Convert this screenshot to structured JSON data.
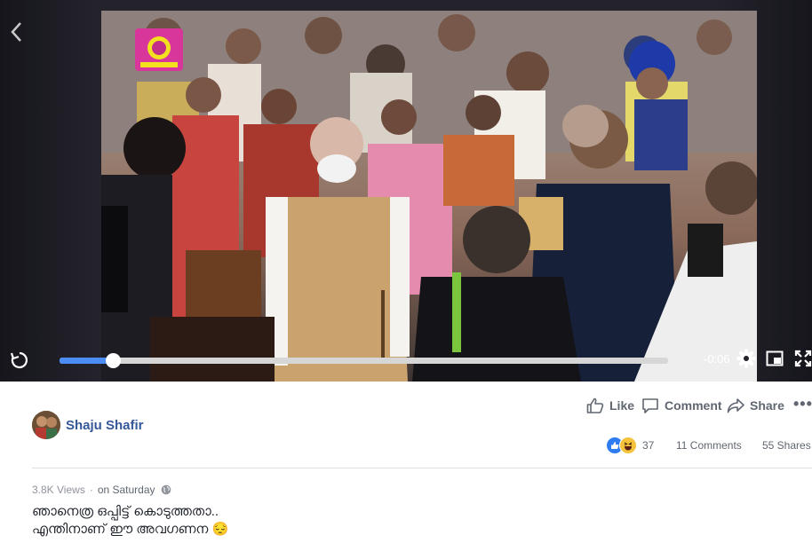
{
  "player": {
    "time_remaining": "-0:06",
    "progress_fraction": 0.087,
    "colors": {
      "progress": "#4c8cf5",
      "track": "#d6d6d6"
    },
    "icons": [
      "back-arrow-icon",
      "replay-icon",
      "settings-gear-icon",
      "picture-in-picture-icon",
      "fullscreen-icon"
    ]
  },
  "actions": {
    "like_label": "Like",
    "comment_label": "Comment",
    "share_label": "Share",
    "more_label": "•••"
  },
  "author": {
    "name": "Shaju Shafir"
  },
  "engagement": {
    "reaction_count": "37",
    "comments": "11 Comments",
    "shares": "55 Shares",
    "reaction_icons": [
      "like-reaction-icon",
      "haha-reaction-icon"
    ]
  },
  "meta": {
    "views": "3.8K Views",
    "separator": "·",
    "posted": "on Saturday",
    "privacy_icon": "globe-icon"
  },
  "caption": {
    "line1": "ഞാനെത്ര ഒപ്പിട്ട് കൊടുത്തതാ..",
    "line2": "എന്തിനാണ് ഈ അവഗണന",
    "emoji": "😔"
  },
  "colors": {
    "link": "#365899",
    "action_text": "#606770",
    "meta_text": "#90949c"
  }
}
